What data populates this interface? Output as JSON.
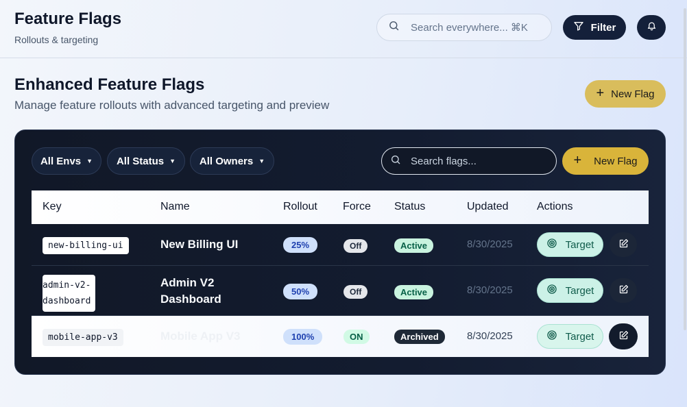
{
  "header": {
    "app_title": "Feature Flags",
    "app_subtitle": "Rollouts & targeting",
    "search_placeholder": "Search everywhere... ⌘K",
    "filter_label": "Filter",
    "search_icon": "search-icon",
    "filter_icon": "filter-icon",
    "bell_icon": "bell-icon"
  },
  "page": {
    "title": "Enhanced Feature Flags",
    "subtitle": "Manage feature rollouts with advanced targeting and preview",
    "new_flag_label": "New Flag"
  },
  "panel": {
    "filters": {
      "envs": "All Envs",
      "status": "All Status",
      "owners": "All Owners"
    },
    "search_placeholder": "Search flags...",
    "new_flag_label": "New Flag",
    "columns": [
      "Key",
      "Name",
      "Rollout",
      "Force",
      "Status",
      "Updated",
      "Actions"
    ],
    "rows": [
      {
        "key": "new-billing-ui",
        "name": "New Billing UI",
        "rollout": "25%",
        "force": "Off",
        "status": "Active",
        "updated": "8/30/2025",
        "target_label": "Target"
      },
      {
        "key": "admin-v2-dashboard",
        "name": "Admin V2 Dashboard",
        "rollout": "50%",
        "force": "Off",
        "status": "Active",
        "updated": "8/30/2025",
        "target_label": "Target"
      },
      {
        "key": "mobile-app-v3",
        "name": "Mobile App V3",
        "rollout": "100%",
        "force": "ON",
        "status": "Archived",
        "updated": "8/30/2025",
        "target_label": "Target"
      }
    ]
  },
  "colors": {
    "accent_gold": "#d9b43a",
    "panel_bg": "#111827",
    "active_green": "#c9f3df",
    "rollout_blue": "#cfe0fb"
  }
}
